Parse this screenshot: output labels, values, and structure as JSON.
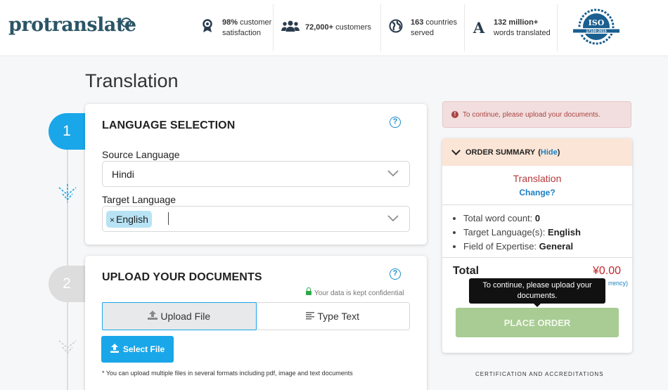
{
  "header": {
    "logo": "protranslate",
    "stats": [
      {
        "icon": "award-icon",
        "bold": "98%",
        "text": " customer satisfaction"
      },
      {
        "icon": "users-icon",
        "bold": "72,000+",
        "text": " customers"
      },
      {
        "icon": "globe-icon",
        "bold": "163",
        "text": " countries served"
      },
      {
        "icon": "letter-a-icon",
        "bold": "132 million+",
        "text": " words translated"
      }
    ],
    "iso_badge": {
      "top": "ISO",
      "bottom": "17100:2015"
    }
  },
  "page": {
    "title": "Translation"
  },
  "steps": [
    {
      "number": "1",
      "title": "LANGUAGE SELECTION"
    },
    {
      "number": "2",
      "title": "UPLOAD YOUR DOCUMENTS"
    }
  ],
  "language": {
    "source_label": "Source Language",
    "source_value": "Hindi",
    "target_label": "Target Language",
    "target_tags": [
      "English"
    ],
    "tag_remove": "×"
  },
  "upload": {
    "confidential_note": "Your data is kept confidential",
    "tabs": [
      {
        "label": "Upload File",
        "icon": "upload-icon",
        "active": true
      },
      {
        "label": "Type Text",
        "icon": "text-lines-icon",
        "active": false
      }
    ],
    "select_file_label": "Select File",
    "formats_note": "* You can upload multiple files in several formats including pdf, image and text documents"
  },
  "alert": {
    "text": "To continue, please upload your documents."
  },
  "summary": {
    "header": "ORDER SUMMARY",
    "hide_link": "Hide",
    "service": "Translation",
    "change_link": "Change?",
    "details": [
      {
        "label": "Total word count: ",
        "value": "0"
      },
      {
        "label": "Target Language(s): ",
        "value": "English"
      },
      {
        "label": "Field of Expertise: ",
        "value": "General"
      }
    ],
    "total_label": "Total",
    "total_value": "¥0.00",
    "currency_link": "rrency)",
    "place_order": "PLACE ORDER",
    "tooltip": "To continue, please upload your documents."
  },
  "footer": {
    "cert_heading": "CERTIFICATION AND ACCREDITATIONS"
  },
  "colors": {
    "accent": "#1aa7e9",
    "logo": "#2b5566",
    "danger": "#c0282d",
    "order_button": "#a8cc94"
  }
}
